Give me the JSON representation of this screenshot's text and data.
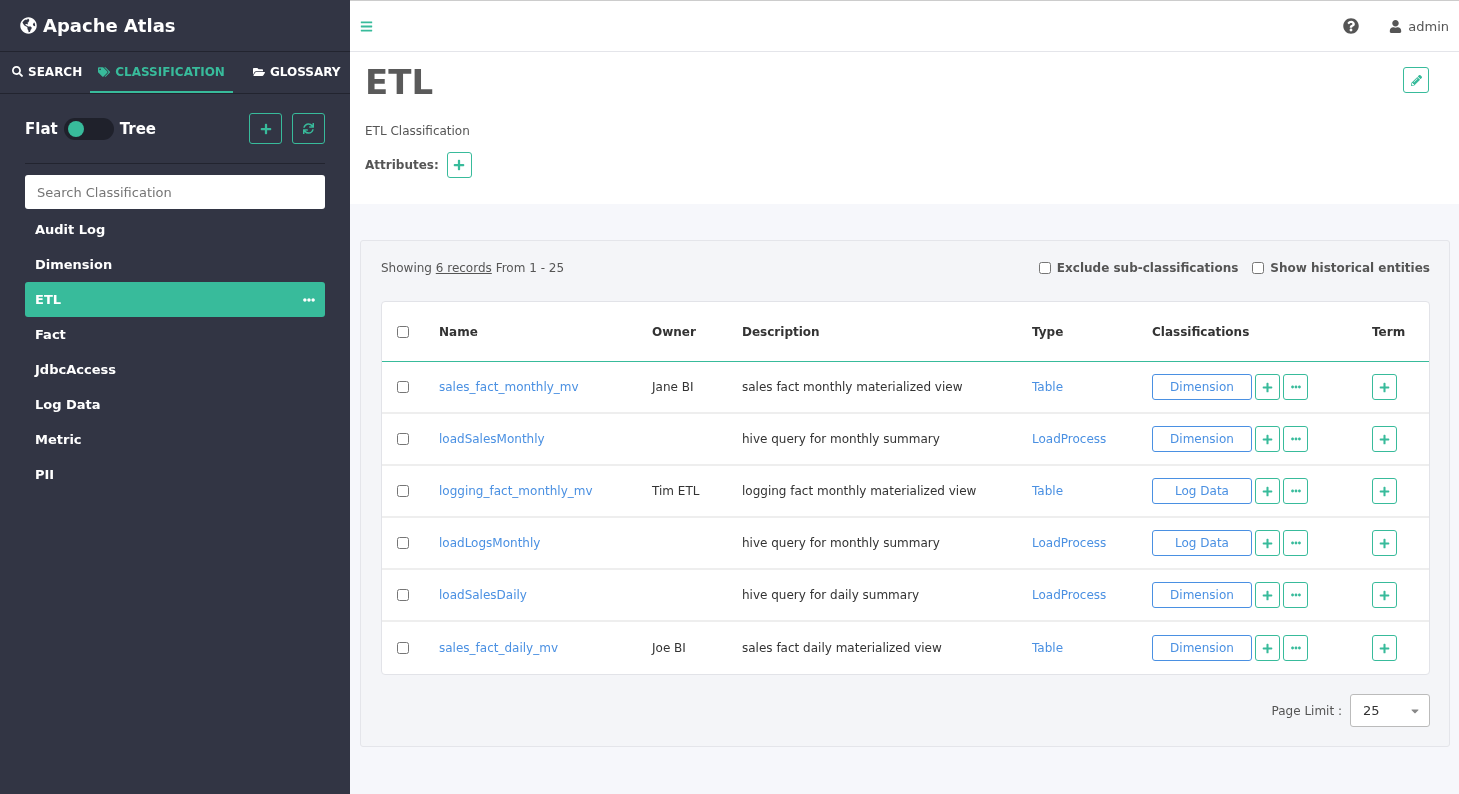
{
  "app": {
    "title": "Apache Atlas"
  },
  "nav_tabs": [
    {
      "label": "SEARCH",
      "selected": false,
      "kind": "search"
    },
    {
      "label": "CLASSIFICATION",
      "selected": true,
      "kind": "tag"
    },
    {
      "label": "GLOSSARY",
      "selected": false,
      "kind": "folder"
    }
  ],
  "view_toggle": {
    "left_label": "Flat",
    "right_label": "Tree",
    "tree": false
  },
  "search": {
    "placeholder": "Search Classification"
  },
  "classifications": [
    {
      "label": "Audit Log",
      "selected": false
    },
    {
      "label": "Dimension",
      "selected": false
    },
    {
      "label": "ETL",
      "selected": true
    },
    {
      "label": "Fact",
      "selected": false
    },
    {
      "label": "JdbcAccess",
      "selected": false
    },
    {
      "label": "Log Data",
      "selected": false
    },
    {
      "label": "Metric",
      "selected": false
    },
    {
      "label": "PII",
      "selected": false
    }
  ],
  "topbar": {
    "user": "admin"
  },
  "detail": {
    "title": "ETL",
    "description": "ETL Classification",
    "attributes_label": "Attributes:"
  },
  "results": {
    "showing": "Showing",
    "records_link": "6 records",
    "range": "From 1 - 25",
    "filters": [
      {
        "label": "Exclude sub-classifications",
        "checked": false
      },
      {
        "label": "Show historical entities",
        "checked": false
      }
    ],
    "select_all_checked": false,
    "columns": [
      "Name",
      "Owner",
      "Description",
      "Type",
      "Classifications",
      "Term"
    ],
    "rows": [
      {
        "checked": false,
        "name": "sales_fact_monthly_mv",
        "owner": "Jane BI",
        "description": "sales fact monthly materialized view",
        "type": "Table",
        "classification": "Dimension"
      },
      {
        "checked": false,
        "name": "loadSalesMonthly",
        "description": "hive query for monthly summary",
        "type": "LoadProcess",
        "classification": "Dimension"
      },
      {
        "checked": false,
        "name": "logging_fact_monthly_mv",
        "owner": "Tim ETL",
        "description": "logging fact monthly materialized view",
        "type": "Table",
        "classification": "Log Data"
      },
      {
        "checked": false,
        "name": "loadLogsMonthly",
        "description": "hive query for monthly summary",
        "type": "LoadProcess",
        "classification": "Log Data"
      },
      {
        "checked": false,
        "name": "loadSalesDaily",
        "description": "hive query for daily summary",
        "type": "LoadProcess",
        "classification": "Dimension"
      },
      {
        "checked": false,
        "name": "sales_fact_daily_mv",
        "owner": "Joe BI",
        "description": "sales fact daily materialized view",
        "type": "Table",
        "classification": "Dimension"
      }
    ],
    "page_limit_label": "Page Limit :",
    "page_limit": "25"
  }
}
